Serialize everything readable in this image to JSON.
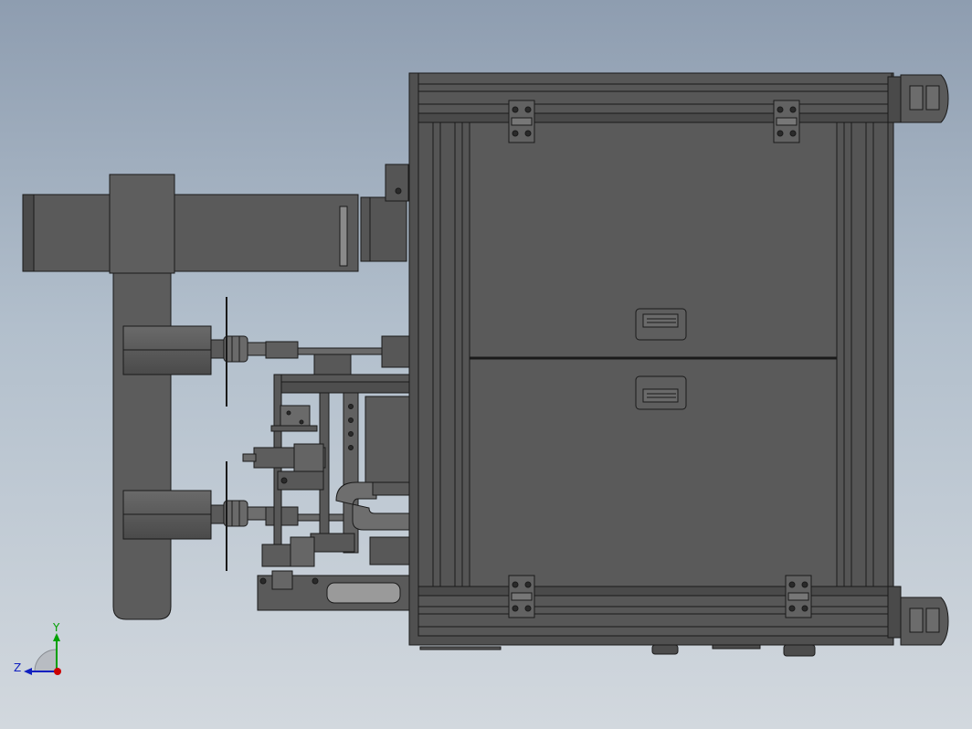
{
  "colors": {
    "background_top": "#8e9db0",
    "background_bottom": "#d2d8de",
    "frame": "#4f4f4f",
    "panel": "#5a5a5a",
    "edge": "#1a1a1a",
    "highlight": "#7a7a7a",
    "axis_x": "#cc0000",
    "axis_y": "#00a000",
    "axis_z": "#1020c0"
  },
  "triad": {
    "y_label": "Y",
    "z_label": "Z"
  }
}
